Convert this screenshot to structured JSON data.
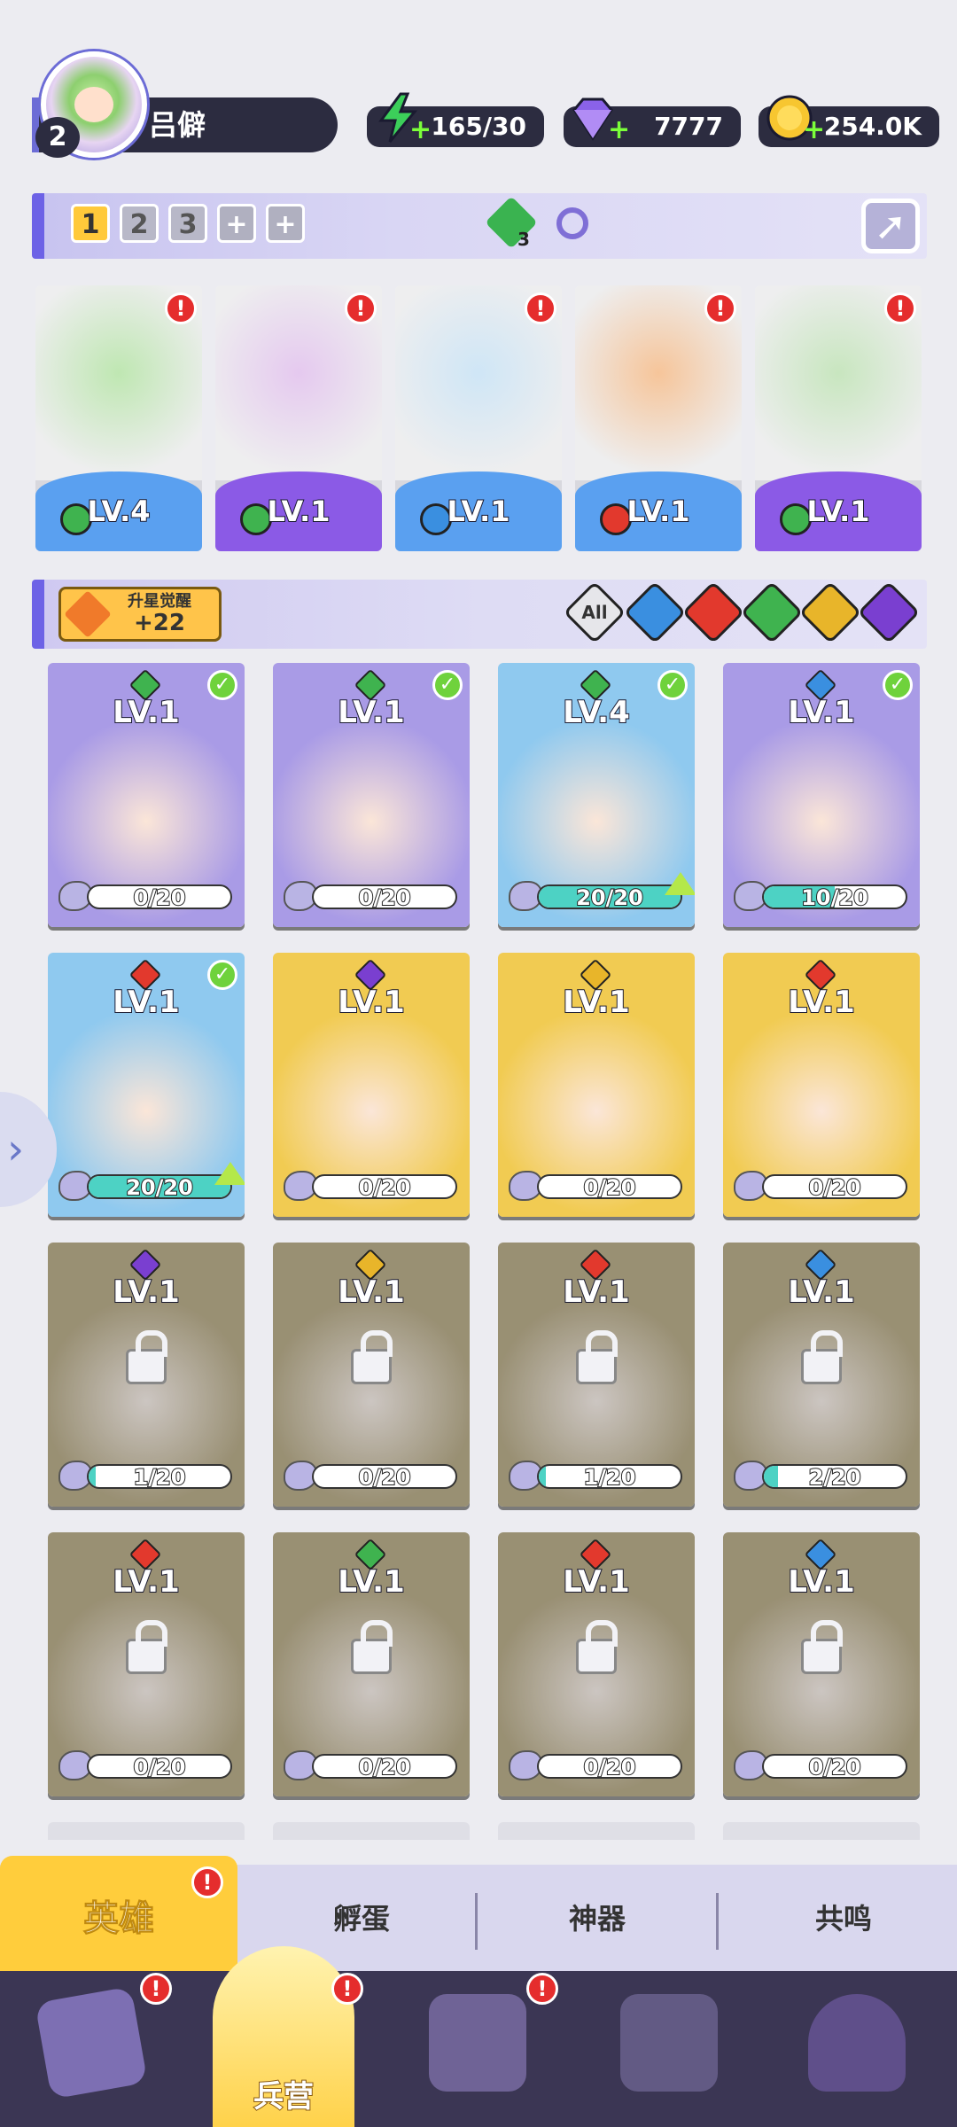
{
  "player": {
    "level": "2",
    "name": "吕僻"
  },
  "resources": {
    "energy": "165/30",
    "gems": "7777",
    "gold": "254.0K"
  },
  "team_bar": {
    "slots": [
      "1",
      "2",
      "3",
      "+",
      "+"
    ],
    "gem_count": "3"
  },
  "team_cards": [
    {
      "level": "LV.4",
      "element": "nature",
      "band_color": "#5aa0f0"
    },
    {
      "level": "LV.1",
      "element": "nature",
      "band_color": "#8b5ae6"
    },
    {
      "level": "LV.1",
      "element": "water",
      "band_color": "#5aa0f0"
    },
    {
      "level": "LV.1",
      "element": "fire",
      "band_color": "#5aa0f0"
    },
    {
      "level": "LV.1",
      "element": "nature",
      "band_color": "#8b5ae6"
    }
  ],
  "filter_bar": {
    "awaken_title": "升星觉醒",
    "awaken_value": "+22",
    "all_label": "All"
  },
  "hero_cards": [
    {
      "level": "LV.1",
      "element": "nature",
      "progress": "0/20",
      "fill": 0,
      "check": true,
      "locked": false,
      "up": false,
      "bg": "#a99be6"
    },
    {
      "level": "LV.1",
      "element": "nature",
      "progress": "0/20",
      "fill": 0,
      "check": true,
      "locked": false,
      "up": false,
      "bg": "#a99be6"
    },
    {
      "level": "LV.4",
      "element": "nature",
      "progress": "20/20",
      "fill": 1,
      "check": true,
      "locked": false,
      "up": true,
      "bg": "#8fc9ef"
    },
    {
      "level": "LV.1",
      "element": "water",
      "progress": "10/20",
      "fill": 0.5,
      "check": true,
      "locked": false,
      "up": false,
      "bg": "#a99be6"
    },
    {
      "level": "LV.1",
      "element": "fire",
      "progress": "20/20",
      "fill": 1,
      "check": true,
      "locked": false,
      "up": true,
      "bg": "#8fc9ef"
    },
    {
      "level": "LV.1",
      "element": "dark",
      "progress": "0/20",
      "fill": 0,
      "check": false,
      "locked": false,
      "up": false,
      "bg": "#f1cb52"
    },
    {
      "level": "LV.1",
      "element": "light",
      "progress": "0/20",
      "fill": 0,
      "check": false,
      "locked": false,
      "up": false,
      "bg": "#f1cb52"
    },
    {
      "level": "LV.1",
      "element": "fire",
      "progress": "0/20",
      "fill": 0,
      "check": false,
      "locked": false,
      "up": false,
      "bg": "#f1cb52"
    },
    {
      "level": "LV.1",
      "element": "dark",
      "progress": "1/20",
      "fill": 0.05,
      "check": false,
      "locked": true,
      "up": false,
      "bg": "#c9a94a"
    },
    {
      "level": "LV.1",
      "element": "light",
      "progress": "0/20",
      "fill": 0,
      "check": false,
      "locked": true,
      "up": false,
      "bg": "#c9a94a"
    },
    {
      "level": "LV.1",
      "element": "fire",
      "progress": "1/20",
      "fill": 0.05,
      "check": false,
      "locked": true,
      "up": false,
      "bg": "#c9a94a"
    },
    {
      "level": "LV.1",
      "element": "water",
      "progress": "2/20",
      "fill": 0.1,
      "check": false,
      "locked": true,
      "up": false,
      "bg": "#c9a94a"
    },
    {
      "level": "LV.1",
      "element": "fire",
      "progress": "0/20",
      "fill": 0,
      "check": false,
      "locked": true,
      "up": false,
      "bg": "#c9a94a"
    },
    {
      "level": "LV.1",
      "element": "nature",
      "progress": "0/20",
      "fill": 0,
      "check": false,
      "locked": true,
      "up": false,
      "bg": "#c9a94a"
    },
    {
      "level": "LV.1",
      "element": "fire",
      "progress": "0/20",
      "fill": 0,
      "check": false,
      "locked": true,
      "up": false,
      "bg": "#c9a94a"
    },
    {
      "level": "LV.1",
      "element": "water",
      "progress": "0/20",
      "fill": 0,
      "check": false,
      "locked": true,
      "up": false,
      "bg": "#c9a94a"
    }
  ],
  "element_colors": {
    "nature": "#3fb34f",
    "water": "#3a8fe0",
    "fire": "#e2392d",
    "light": "#e8b52a",
    "dark": "#7a3fd0"
  },
  "subtabs": {
    "heroes": "英雄",
    "hatch": "孵蛋",
    "artifact": "神器",
    "resonance": "共鸣"
  },
  "nav": {
    "barracks": "兵营"
  },
  "alert_mark": "!"
}
